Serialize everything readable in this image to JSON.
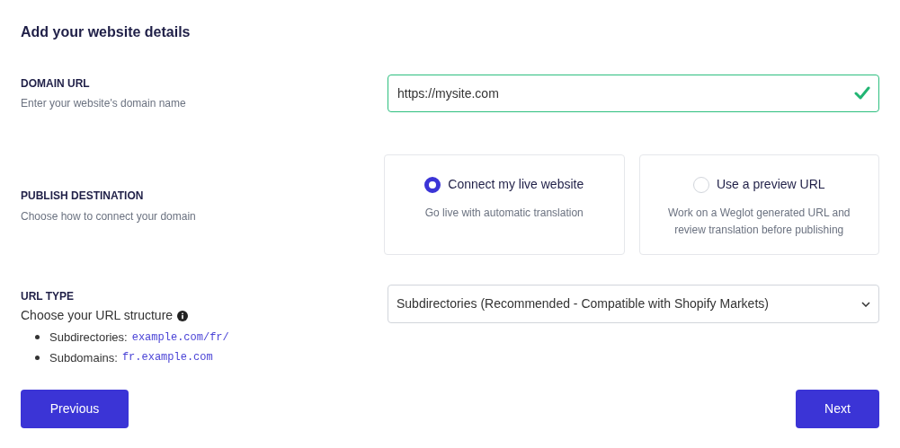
{
  "title": "Add your website details",
  "domain": {
    "label": "DOMAIN URL",
    "hint": "Enter your website's domain name",
    "value": "https://mysite.com",
    "valid": true
  },
  "publish": {
    "label": "PUBLISH DESTINATION",
    "hint": "Choose how to connect your domain",
    "options": [
      {
        "title": "Connect my live website",
        "description": "Go live with automatic translation",
        "selected": true
      },
      {
        "title": "Use a preview URL",
        "description": "Work on a Weglot generated URL and review translation before publishing",
        "selected": false
      }
    ]
  },
  "url_type": {
    "label": "URL TYPE",
    "hint": "Choose your URL structure",
    "examples": [
      {
        "label": "Subdirectories:",
        "code": "example.com/fr/"
      },
      {
        "label": "Subdomains:",
        "code": "fr.example.com"
      }
    ],
    "value": "Subdirectories (Recommended - Compatible with Shopify Markets)"
  },
  "buttons": {
    "previous": "Previous",
    "next": "Next"
  }
}
